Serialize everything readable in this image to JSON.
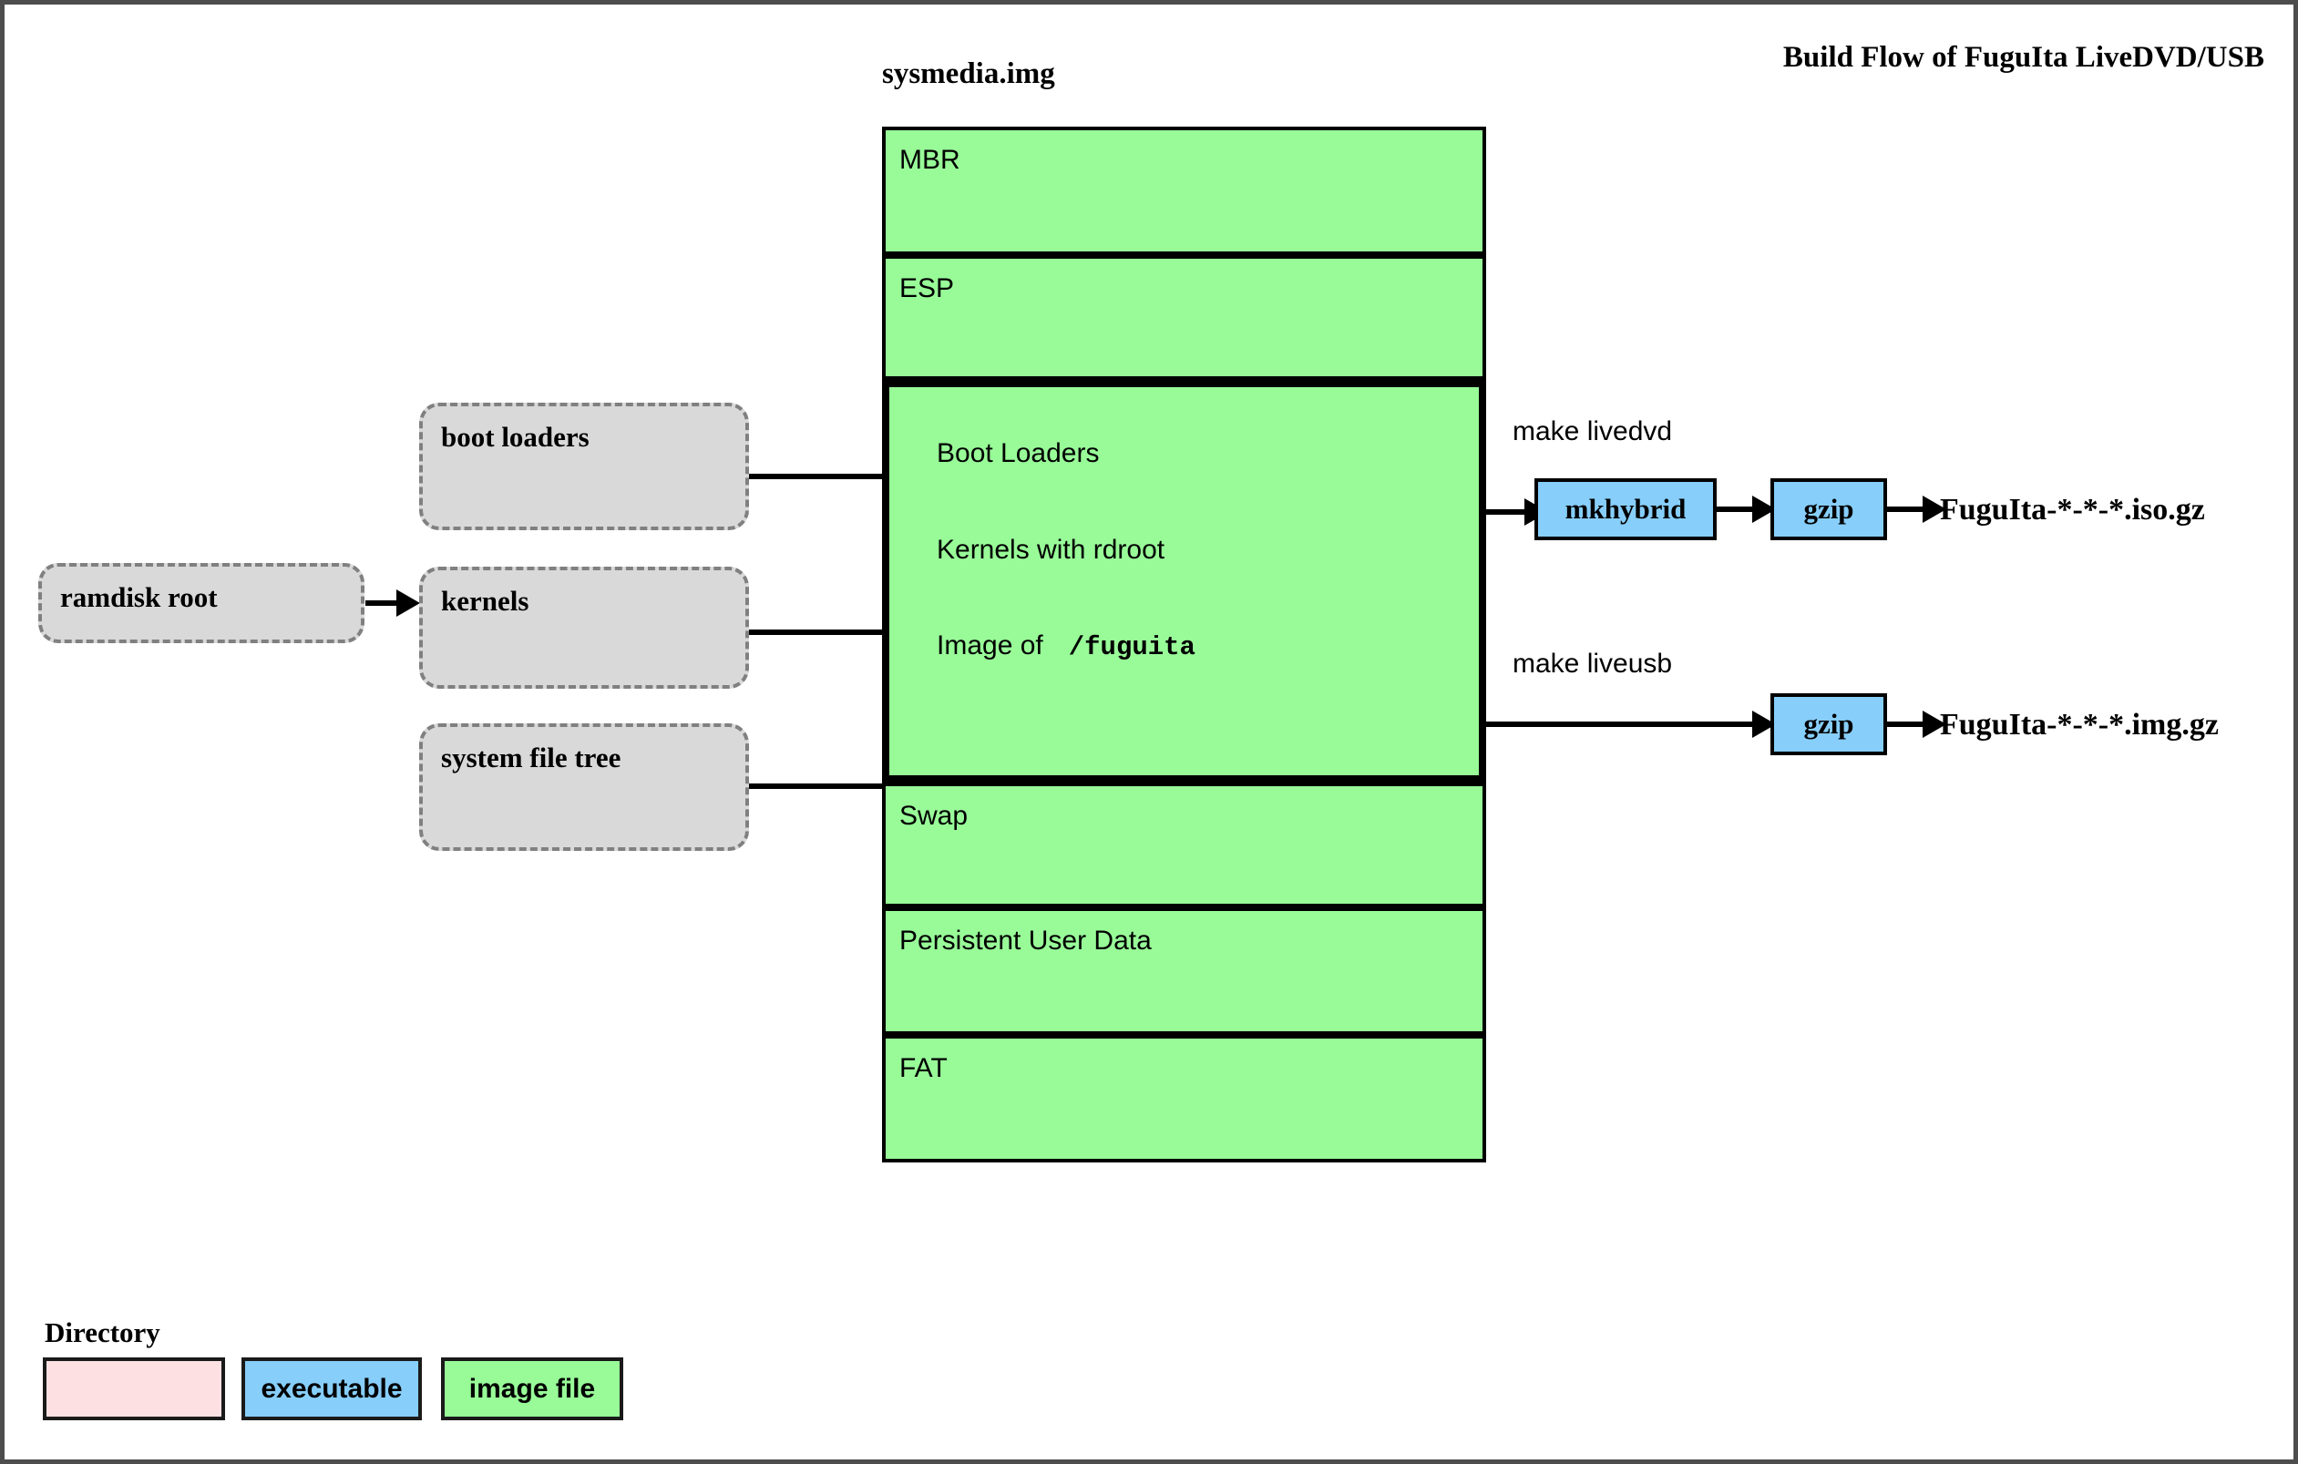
{
  "page": {
    "title": "Build Flow of FuguIta LiveDVD/USB",
    "border_color": "#4d4d4d"
  },
  "colors": {
    "directory_fill": "#d9d9d9",
    "directory_border": "#808080",
    "legend_directory_fill": "#fce0e2",
    "executable_fill": "#87cefa",
    "image_file_fill": "#98fb98",
    "stroke": "#000000"
  },
  "sources": {
    "ramdisk_root": {
      "label": "ramdisk root"
    },
    "directories": [
      {
        "label": "boot loaders"
      },
      {
        "label": "kernels"
      },
      {
        "label": "system file tree"
      }
    ]
  },
  "sysmedia": {
    "title": "sysmedia.img",
    "partitions": [
      {
        "label": "MBR",
        "thick": false
      },
      {
        "label": "ESP",
        "thick": false
      },
      {
        "label": "Boot Loaders",
        "thick": true
      },
      {
        "label": "Kernels with rdroot",
        "thick": true
      },
      {
        "label": "Image of",
        "thick": true,
        "mono": "/fuguita"
      },
      {
        "label": "Swap",
        "thick": false
      },
      {
        "label": "Persistent User Data",
        "thick": false
      },
      {
        "label": "FAT",
        "thick": false
      }
    ]
  },
  "targets": {
    "livedvd": {
      "make_label": "make livedvd",
      "steps": [
        {
          "label": "mkhybrid"
        },
        {
          "label": "gzip"
        }
      ],
      "output": "FuguIta-*-*-*.iso.gz"
    },
    "liveusb": {
      "make_label": "make liveusb",
      "steps": [
        {
          "label": "gzip"
        }
      ],
      "output": "FuguIta-*-*-*.img.gz"
    }
  },
  "legend": {
    "directory_caption": "Directory",
    "executable_label": "executable",
    "image_file_label": "image file"
  }
}
